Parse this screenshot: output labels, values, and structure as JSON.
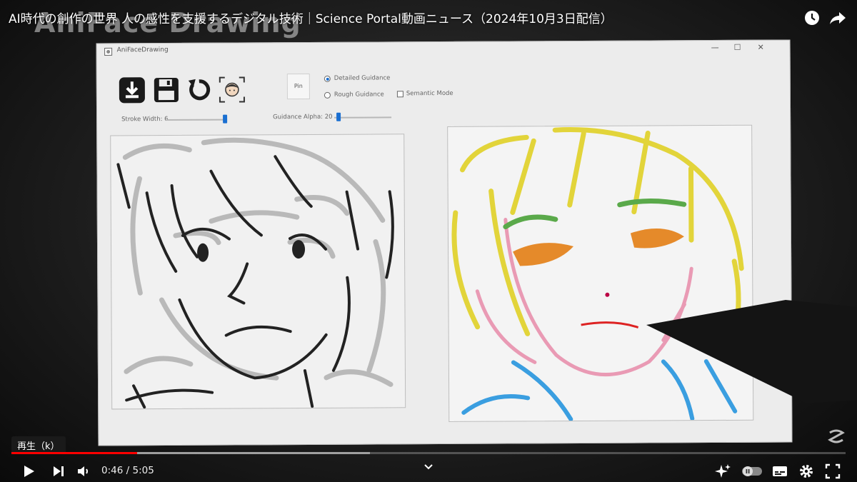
{
  "video": {
    "title": "AI時代の創作の世界 人の感性を支援するデジタル技術｜Science Portal動画ニュース（2024年10月3日配信）",
    "overlay_text": "AniFace Drawing"
  },
  "app": {
    "window_title": "AniFaceDrawing",
    "pin_label": "Pin",
    "guidance_options": [
      "Detailed Guidance",
      "Rough Guidance"
    ],
    "selected_guidance": "Detailed Guidance",
    "semantic_mode_label": "Semantic Mode",
    "semantic_mode_checked": false,
    "stroke_width_label": "Stroke Width: 6",
    "stroke_width_value": 6,
    "guidance_alpha_label": "Guidance Alpha: 20",
    "guidance_alpha_value": 20,
    "accent_color": "#1a6fd1"
  },
  "player": {
    "tooltip": "再生（k）",
    "current_time": "0:46",
    "separator": "/",
    "duration": "5:05",
    "played_fraction": 0.151,
    "buffered_fraction": 0.43,
    "progress_color": "#ff0000"
  },
  "icons": [
    "watch-later-icon",
    "share-icon",
    "download-icon",
    "save-icon",
    "undo-icon",
    "face-icon",
    "play-icon",
    "next-icon",
    "volume-icon",
    "chevron-down-icon",
    "sparkle-icon",
    "autoplay-toggle-icon",
    "subtitles-icon",
    "settings-icon",
    "fullscreen-icon"
  ]
}
